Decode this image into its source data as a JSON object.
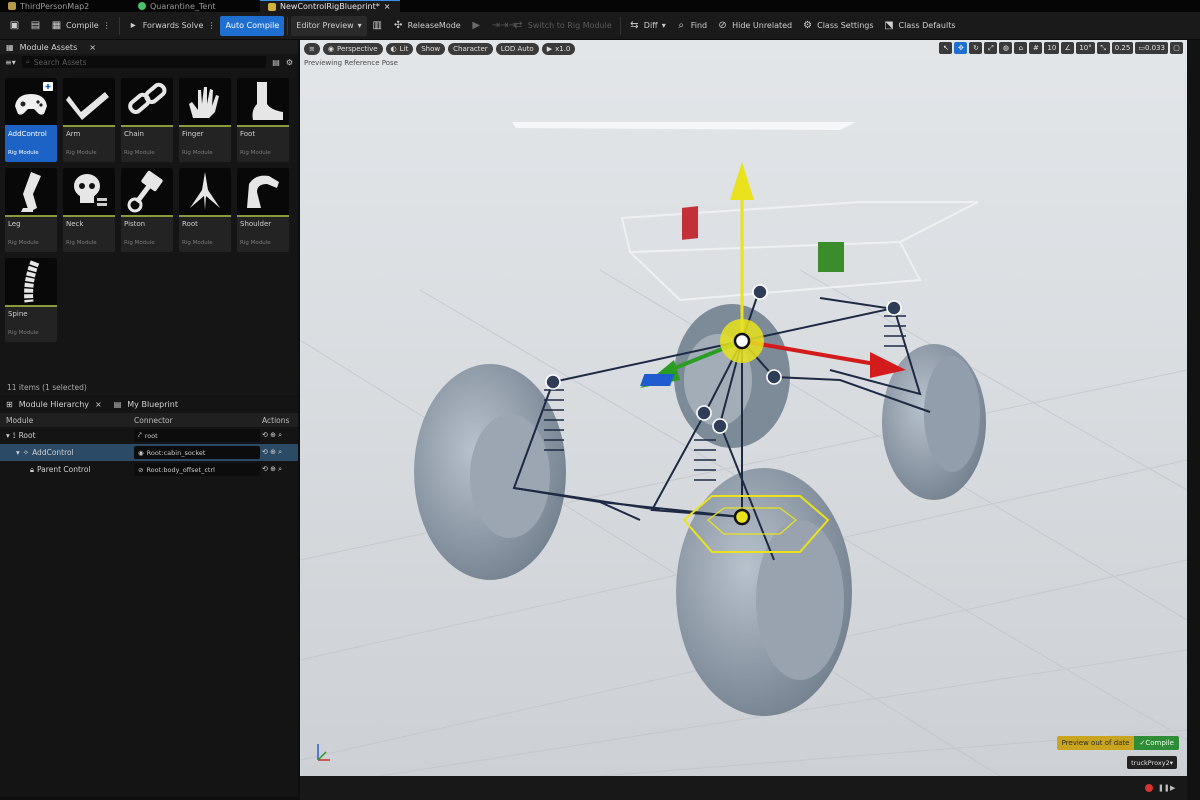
{
  "tabs": [
    {
      "label": "ThirdPersonMap2",
      "active": false,
      "icon": "level-icon",
      "color": "#b59a4a"
    },
    {
      "label": "Quarantine_Tent",
      "active": false,
      "icon": "static-mesh-icon",
      "color": "#4ac06b"
    },
    {
      "label": "NewControlRigBlueprint*",
      "active": true,
      "icon": "control-rig-icon",
      "color": "#d2b03a"
    }
  ],
  "tab_close": "×",
  "toolbar": {
    "compile": "Compile",
    "forwards_solve": "Forwards Solve",
    "auto_compile": "Auto Compile",
    "editor_preview": "Editor Preview",
    "release_mode": "ReleaseMode",
    "switch_rig_module": "Switch to Rig Module",
    "diff": "Diff",
    "find": "Find",
    "hide_unrelated": "Hide Unrelated",
    "class_settings": "Class Settings",
    "class_defaults": "Class Defaults"
  },
  "module_assets": {
    "title": "Module Assets",
    "search_placeholder": "Search Assets",
    "items": [
      {
        "name": "AddControl",
        "type": "Rig Module",
        "icon": "gamepad-icon",
        "selected": true
      },
      {
        "name": "Arm",
        "type": "Rig Module",
        "icon": "arm-icon",
        "selected": false
      },
      {
        "name": "Chain",
        "type": "Rig Module",
        "icon": "chain-icon",
        "selected": false
      },
      {
        "name": "Finger",
        "type": "Rig Module",
        "icon": "hand-icon",
        "selected": false
      },
      {
        "name": "Foot",
        "type": "Rig Module",
        "icon": "foot-icon",
        "selected": false
      },
      {
        "name": "Leg",
        "type": "Rig Module",
        "icon": "leg-icon",
        "selected": false
      },
      {
        "name": "Neck",
        "type": "Rig Module",
        "icon": "skull-icon",
        "selected": false
      },
      {
        "name": "Piston",
        "type": "Rig Module",
        "icon": "piston-icon",
        "selected": false
      },
      {
        "name": "Root",
        "type": "Rig Module",
        "icon": "root-icon",
        "selected": false
      },
      {
        "name": "Shoulder",
        "type": "Rig Module",
        "icon": "shoulder-icon",
        "selected": false
      },
      {
        "name": "Spine",
        "type": "Rig Module",
        "icon": "spine-icon",
        "selected": false
      }
    ],
    "count": "11 items (1 selected)"
  },
  "hierarchy": {
    "tab1": "Module Hierarchy",
    "tab2": "My Blueprint",
    "col_module": "Module",
    "col_connector": "Connector",
    "col_actions": "Actions",
    "rows": [
      {
        "name": "Root",
        "connector": "root"
      },
      {
        "name": "AddControl",
        "connector": "Root:cabin_socket"
      },
      {
        "name": "Parent Control",
        "connector": "Root:body_offset_ctrl"
      }
    ]
  },
  "viewport": {
    "perspective": "Perspective",
    "lit": "Lit",
    "show": "Show",
    "character": "Character",
    "lod": "LOD Auto",
    "speed": "x1.0",
    "status": "Previewing Reference Pose",
    "grid_snap": "10",
    "rot_snap": "10°",
    "scale_snap": "0.25",
    "cam_speed": "0.033",
    "preview_warning": "Preview out of date",
    "compile_button": "Compile",
    "proxy": "truckProxy2"
  },
  "colors": {
    "accent": "#1f6fd1",
    "gizmo_yellow": "#e9e21c",
    "gizmo_red": "#d41b1b",
    "gizmo_green": "#2a9d22",
    "tire": "#8e9aa8"
  }
}
